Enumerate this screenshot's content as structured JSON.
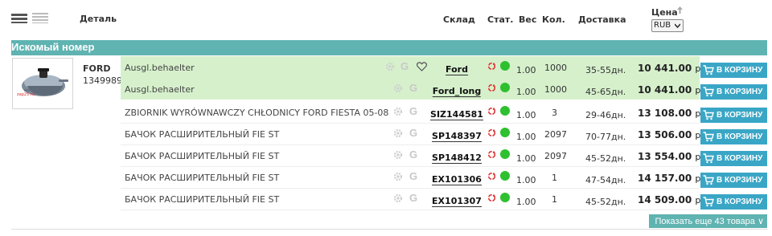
{
  "header": {
    "detail": "Деталь",
    "warehouse": "Склад",
    "status": "Стат.",
    "weight": "Вес",
    "quantity": "Кол.",
    "delivery": "Доставка",
    "price": "Цена",
    "currency": "RUB"
  },
  "section_title": "Искомый номер",
  "product": {
    "brand": "FORD",
    "article": "1349989",
    "image_label": "zap25.ru"
  },
  "rows": [
    {
      "desc": "Ausgl.behaelter",
      "warehouse": "Ford",
      "weight": "1.00",
      "qty": "1000",
      "delivery": "35-55дн.",
      "price": "10 441.00",
      "highlight": true,
      "heart": true
    },
    {
      "desc": "Ausgl.behaelter",
      "warehouse": "Ford_long",
      "weight": "1.00",
      "qty": "1000",
      "delivery": "45-65дн.",
      "price": "10 441.00",
      "highlight": true,
      "heart": false
    },
    {
      "desc": "ZBIORNIK WYRÓWNAWCZY CHŁODNICY FORD FIESTA 05-08",
      "warehouse": "SIZ144581",
      "weight": "1.00",
      "qty": "3",
      "delivery": "29-46дн.",
      "price": "13 108.00",
      "highlight": false,
      "heart": false
    },
    {
      "desc": "БАЧОК РАСШИРИТЕЛЬНЫЙ FIE ST",
      "warehouse": "SP148397",
      "weight": "1.00",
      "qty": "2097",
      "delivery": "70-77дн.",
      "price": "13 506.00",
      "highlight": false,
      "heart": false
    },
    {
      "desc": "БАЧОК РАСШИРИТЕЛЬНЫЙ FIE ST",
      "warehouse": "SP148412",
      "weight": "1.00",
      "qty": "2097",
      "delivery": "45-52дн.",
      "price": "13 554.00",
      "highlight": false,
      "heart": false
    },
    {
      "desc": "БАЧОК РАСШИРИТЕЛЬНЫЙ FIE ST",
      "warehouse": "EX101306",
      "weight": "1.00",
      "qty": "1",
      "delivery": "47-54дн.",
      "price": "14 157.00",
      "highlight": false,
      "heart": false
    },
    {
      "desc": "БАЧОК РАСШИРИТЕЛЬНЫЙ FIE ST",
      "warehouse": "EX101307",
      "weight": "1.00",
      "qty": "1",
      "delivery": "45-52дн.",
      "price": "14 509.00",
      "highlight": false,
      "heart": false
    }
  ],
  "labels": {
    "currency_suffix": "р.",
    "add_to_cart": "В КОРЗИНУ",
    "g_icon": "G",
    "show_more": "Показать еще 43 товара ∨"
  },
  "colors": {
    "accent": "#5fb3b1",
    "cart": "#3aa6c6",
    "highlight_row": "#d6f0cc",
    "status_green": "#2fc02f",
    "recycle_red": "#e03030"
  },
  "icons": {
    "view_list_compact": "list-compact-icon",
    "view_list": "list-icon",
    "sort": "sort-arrow-up-icon",
    "settings": "gear-icon",
    "google": "g-icon",
    "favorite": "heart-icon",
    "return": "recycle-icon",
    "status": "status-dot-icon",
    "cart": "cart-icon"
  }
}
